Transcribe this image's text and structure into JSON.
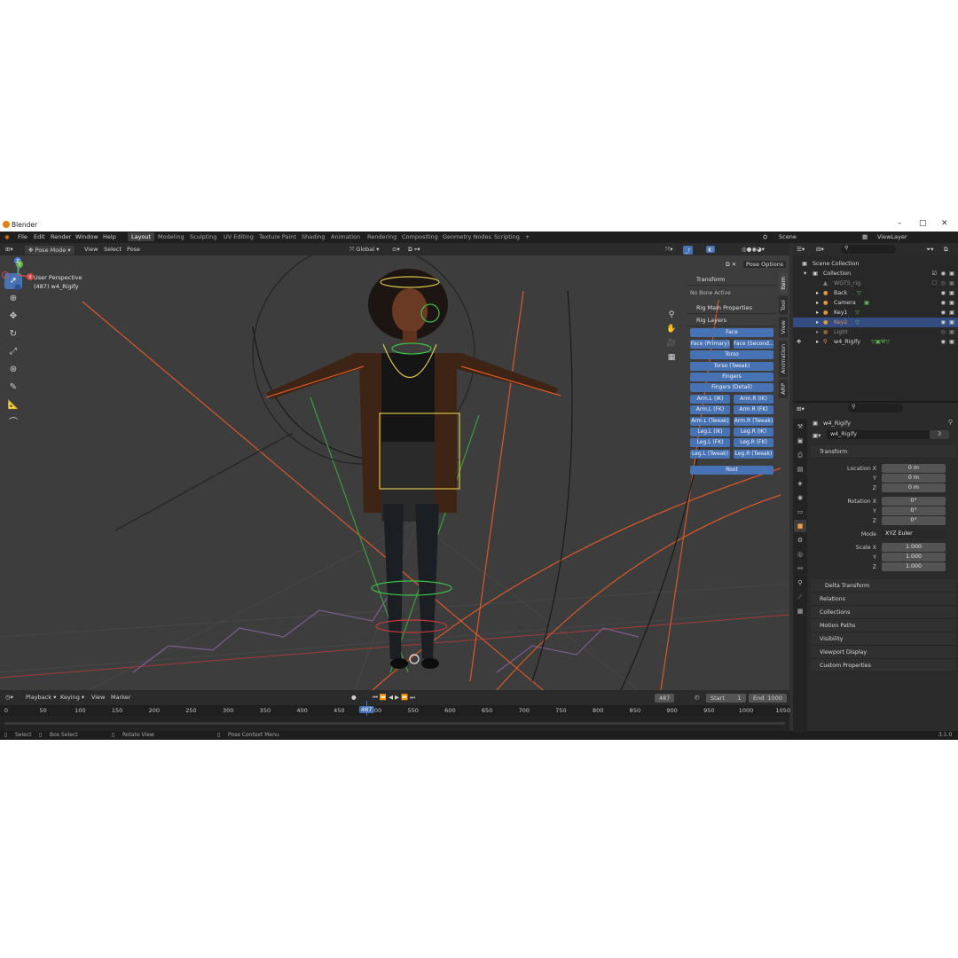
{
  "window": {
    "title": "Blender",
    "minimize": "–",
    "maximize": "□",
    "close": "✕"
  },
  "menus": [
    "File",
    "Edit",
    "Render",
    "Window",
    "Help"
  ],
  "workspaces": [
    "Layout",
    "Modeling",
    "Sculpting",
    "UV Editing",
    "Texture Paint",
    "Shading",
    "Animation",
    "Rendering",
    "Compositing",
    "Geometry Nodes",
    "Scripting"
  ],
  "workspace_add": "+",
  "scene": {
    "name": "Scene",
    "view_layer": "ViewLayer"
  },
  "viewport_header": {
    "mode": "Pose Mode",
    "view": "View",
    "select": "Select",
    "pose": "Pose",
    "orientation": "Global",
    "pose_options": "Pose Options"
  },
  "viewport": {
    "perspective": "User Perspective",
    "object_info": "(487) w4_Rigify"
  },
  "gizmo": {
    "x": "X",
    "y": "Y",
    "z": "Z"
  },
  "npanel": {
    "transform": "Transform",
    "no_bone": "No Bone Active",
    "rig_main": "Rig Main Properties",
    "rig_layers": "Rig Layers",
    "layers_single_top": [
      "Face"
    ],
    "face_pair": [
      "Face (Primary)",
      "Face (Second..."
    ],
    "layers_single_mid": [
      "Torso",
      "Torso (Tweak)",
      "Fingers",
      "Fingers (Detail)"
    ],
    "pairs": [
      [
        "Arm.L (IK)",
        "Arm.R (IK)"
      ],
      [
        "Arm.L (FK)",
        "Arm.R (FK)"
      ],
      [
        "Arm.L (Tweak)",
        "Arm.R (Tweak)"
      ],
      [
        "Leg.L (IK)",
        "Leg.R (IK)"
      ],
      [
        "Leg.L (FK)",
        "Leg.R (FK)"
      ],
      [
        "Leg.L (Tweak)",
        "Leg.R (Tweak)"
      ]
    ],
    "root": "Root"
  },
  "side_tabs": [
    "Item",
    "Tool",
    "View",
    "Animation",
    "ARP"
  ],
  "timeline": {
    "playback": "Playback",
    "keying": "Keying",
    "view": "View",
    "marker": "Marker",
    "current_frame": "487",
    "start_label": "Start",
    "start": "1",
    "end_label": "End",
    "end": "1000",
    "ticks": [
      "0",
      "50",
      "100",
      "150",
      "200",
      "250",
      "300",
      "350",
      "400",
      "450",
      "500",
      "550",
      "600",
      "650",
      "700",
      "750",
      "800",
      "850",
      "900",
      "950",
      "1000",
      "1050"
    ],
    "playhead": "487"
  },
  "status_bar": {
    "select": "Select",
    "box_select": "Box Select",
    "rotate_view": "Rotate View",
    "context_menu": "Pose Context Menu",
    "version": "3.1.0"
  },
  "outliner": {
    "scene_collection": "Scene Collection",
    "collection": "Collection",
    "items": [
      "WGTS_rig",
      "Back",
      "Camera",
      "Key1",
      "Key2",
      "Light",
      "w4_Rigify"
    ]
  },
  "properties": {
    "object_name": "w4_Rigify",
    "data_name": "w4_Rigify",
    "users": "3",
    "transform": "Transform",
    "location_x_label": "Location X",
    "location_x": "0 m",
    "location_y_label": "Y",
    "location_y": "0 m",
    "location_z_label": "Z",
    "location_z": "0 m",
    "rotation_x_label": "Rotation X",
    "rotation_x": "0°",
    "rotation_y_label": "Y",
    "rotation_y": "0°",
    "rotation_z_label": "Z",
    "rotation_z": "0°",
    "mode_label": "Mode",
    "mode": "XYZ Euler",
    "scale_x_label": "Scale X",
    "scale_x": "1.000",
    "scale_y_label": "Y",
    "scale_y": "1.000",
    "scale_z_label": "Z",
    "scale_z": "1.000",
    "sections": [
      "Delta Transform",
      "Relations",
      "Collections",
      "Motion Paths",
      "Visibility",
      "Viewport Display",
      "Custom Properties"
    ]
  },
  "colors": {
    "accent": "#4772b3",
    "bone_orange": "#e0622a",
    "bone_yellow": "#d8c24a",
    "bone_green": "#3ec04a"
  }
}
